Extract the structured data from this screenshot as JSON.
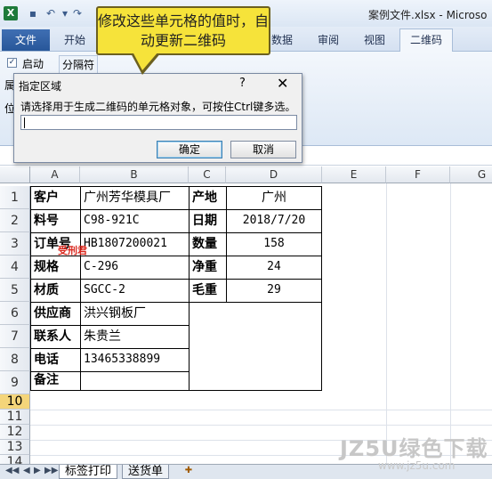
{
  "window": {
    "title": "案例文件.xlsx - Microso"
  },
  "ribbon": {
    "tabs": [
      "文件",
      "开始",
      "数据",
      "审阅",
      "视图",
      "二维码"
    ],
    "active_tab": "二维码",
    "options": {
      "checkbox_label": "启动",
      "checkbox_checked": true,
      "separator_button": "分隔符"
    },
    "side_chars": [
      "属",
      "位"
    ]
  },
  "callout": {
    "text": "修改这些单元格的值时，自动更新二维码"
  },
  "dialog": {
    "title": "指定区域",
    "help": "?",
    "close": "✕",
    "prompt": "请选择用于生成二维码的单元格对象，可按住Ctrl键多选。",
    "input_value": "",
    "ok_label": "确定",
    "cancel_label": "取消"
  },
  "grid": {
    "columns": [
      "A",
      "B",
      "C",
      "D",
      "E",
      "F",
      "G"
    ],
    "rows": [
      "1",
      "2",
      "3",
      "4",
      "5",
      "6",
      "7",
      "8",
      "9",
      "10",
      "11",
      "12",
      "13",
      "14"
    ],
    "active_row": "11",
    "cells": {
      "A1": "客户",
      "B1": "广州芳华模具厂",
      "C1": "产地",
      "D1": "广州",
      "A2": "料号",
      "B2": "C98-921C",
      "C2": "日期",
      "D2": "2018/7/20",
      "A3": "订单号",
      "B3": "HB1807200021",
      "C3": "数量",
      "D3": "158",
      "A4": "规格",
      "B4": "C-296",
      "C4": "净重",
      "D4": "24",
      "A5": "材质",
      "B5": "SGCC-2",
      "C5": "毛重",
      "D5": "29",
      "A6": "供应商",
      "B6": "洪兴钢板厂",
      "A7": "联系人",
      "B7": "朱贵兰",
      "A8": "电话",
      "B8": "13465338899",
      "A9": "备注",
      "B9": ""
    },
    "overlay_label": "受刑君"
  },
  "sheets": {
    "tabs": [
      "标签打印",
      "送货单"
    ],
    "active": "标签打印"
  },
  "watermark": {
    "brand": "JZ5U绿色下载",
    "url": "www.jz5u.com"
  }
}
